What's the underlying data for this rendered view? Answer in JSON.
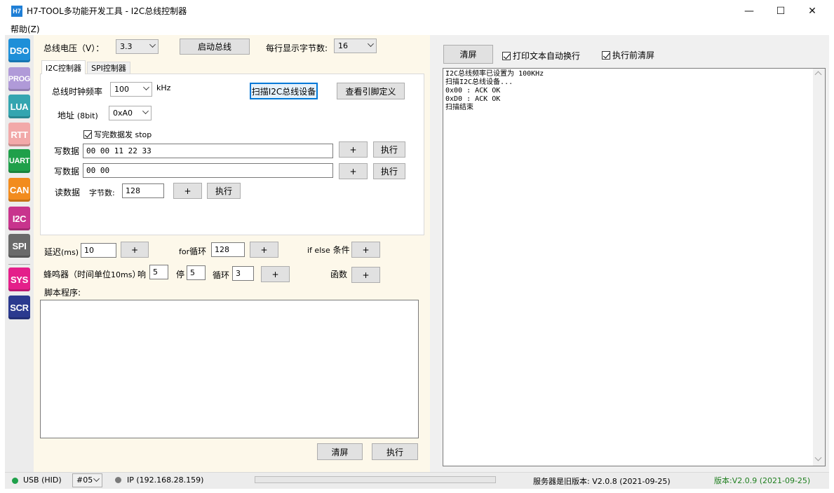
{
  "window": {
    "icon_text": "H7",
    "title": "H7-TOOL多功能开发工具 - I2C总线控制器",
    "minimize": "—",
    "maximize": "☐",
    "close": "✕"
  },
  "menu": {
    "help": "帮助(Z)"
  },
  "modules": [
    {
      "label": "DSO",
      "color": "#1e8fd8"
    },
    {
      "label": "PROG",
      "color": "#b09ad8"
    },
    {
      "label": "LUA",
      "color": "#34a5b0"
    },
    {
      "label": "RTT",
      "color": "#f2a9a9"
    },
    {
      "label": "UART",
      "color": "#1fa04a"
    },
    {
      "label": "CAN",
      "color": "#f28c1e"
    },
    {
      "label": "I2C",
      "color": "#c8348d"
    },
    {
      "label": "SPI",
      "color": "#6a6a6a"
    },
    {
      "label": "SYS",
      "color": "#e41f8a"
    },
    {
      "label": "SCR",
      "color": "#2b3a8f"
    }
  ],
  "top": {
    "voltage_label": "总线电压（V）：",
    "voltage_value": "3.3",
    "start_bus": "启动总线",
    "bytes_per_line_label": "每行显示字节数:",
    "bytes_per_line_value": "16"
  },
  "tabs": [
    "I2C控制器",
    "SPI控制器"
  ],
  "i2c": {
    "clock_label": "总线时钟频率",
    "clock_value": "100",
    "clock_unit": "kHz",
    "scan_button": "扫描I2C总线设备",
    "pin_button": "查看引脚定义",
    "addr_label": "地址",
    "addr_hint": "(8bit)",
    "addr_value": "0xA0",
    "stop_label": "写完数据发 stop",
    "write1_label": "写数据",
    "write1_value": "00 00 11 22 33",
    "write2_label": "写数据",
    "write2_value": "00 00",
    "read_label": "读数据",
    "bytes_label": "字节数:",
    "bytes_value": "128",
    "plus": "+",
    "exec": "执行"
  },
  "script": {
    "delay_label": "延迟",
    "delay_unit": "(ms)",
    "delay_value": "10",
    "for_label_en": "for",
    "for_label_cn": "循环",
    "for_value": "128",
    "ifelse_label_en": "if else",
    "ifelse_label_cn": "条件",
    "beep_label": "蜂鸣器（时间单位",
    "beep_unit": "10ms",
    "beep_close": "）",
    "beep_on": "响",
    "beep_on_value": "5",
    "beep_off": "停",
    "beep_off_value": "5",
    "beep_loop": "循环",
    "beep_loop_value": "3",
    "func_label": "函数",
    "program_label": "脚本程序:",
    "clear": "清屏",
    "exec": "执行",
    "plus": "+"
  },
  "right": {
    "clear": "清屏",
    "autowrap_label": "打印文本自动换行",
    "clear_before_label": "执行前清屏",
    "log_lines": [
      "I2C总线频率已设置为 100KHz",
      "扫描I2C总线设备...",
      "0x00 : ACK OK",
      "0xD0 : ACK OK",
      "扫描结束"
    ]
  },
  "status": {
    "usb": "USB (HID)",
    "usb_color": "#1fa04a",
    "device": "#05",
    "ip": "IP (192.168.28.159)",
    "ip_color": "#7a7a7a",
    "server_version": "服务器是旧版本: V2.0.8 (2021-09-25)",
    "local_version": "版本:V2.0.9 (2021-09-25)",
    "local_version_color": "#1f7f1f"
  }
}
